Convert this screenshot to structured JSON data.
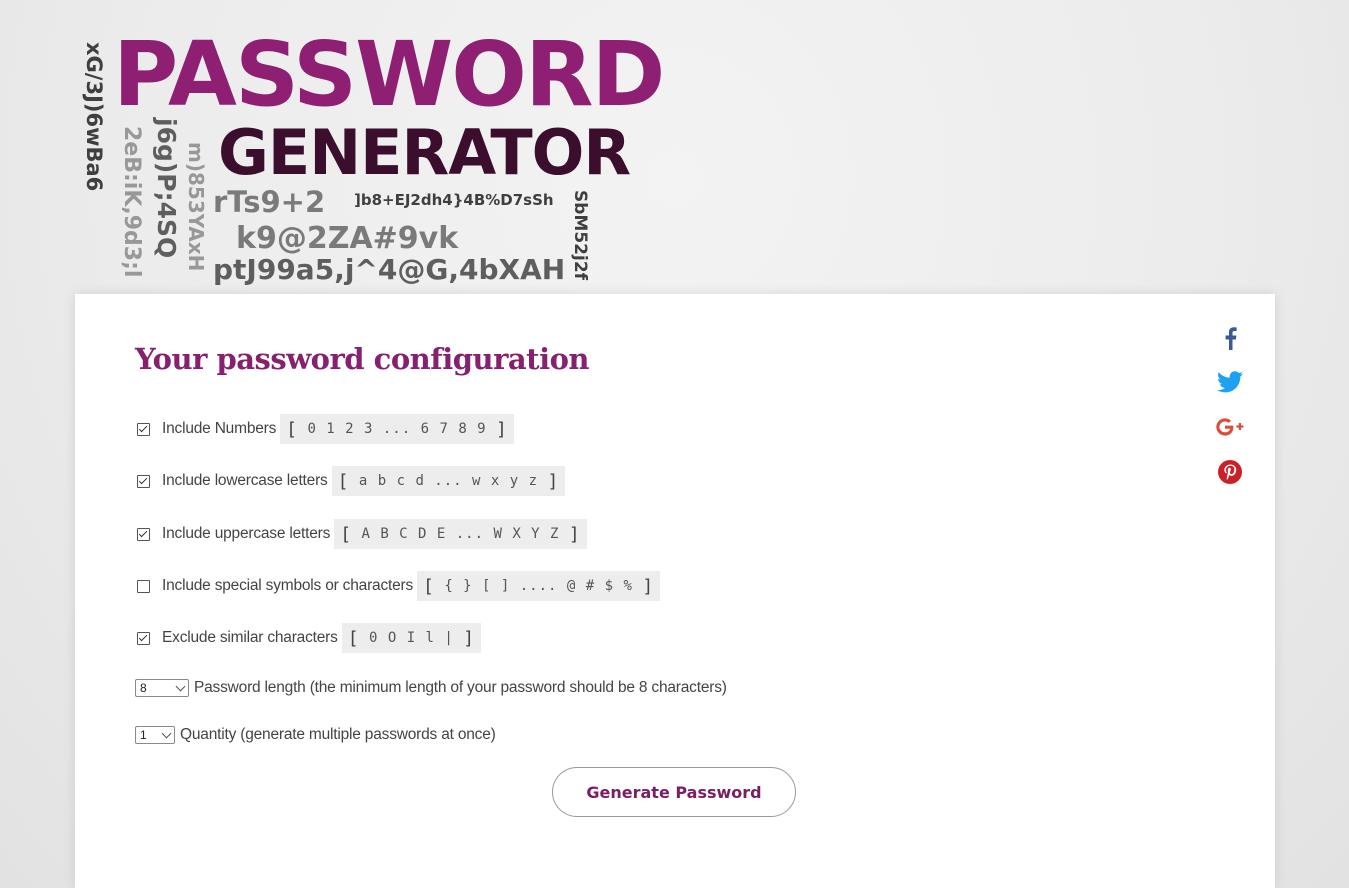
{
  "logo": {
    "title": "PASSWORD",
    "subtitle": "GENERATOR",
    "samples": {
      "s1": "xG/3J)6wBa6",
      "s2": "2eB:iK,9d3;l",
      "s3": "j6g)P;4SQ",
      "s4": "m)853YAxH",
      "s5": "rTs9+2",
      "s6": "]b8+EJ2dh4}4B%D7sSh",
      "s7": "k9@2ZA#9vk",
      "s8": "ptJ99a5,j^4@G,4bXAH",
      "s9": "SbM52j2f"
    }
  },
  "config": {
    "title": "Your password configuration",
    "options": [
      {
        "label": "Include Numbers",
        "chars": "0 1 2 3 ... 6 7 8 9",
        "checked": true
      },
      {
        "label": "Include lowercase letters",
        "chars": "a b c d ... w x y z",
        "checked": true
      },
      {
        "label": "Include uppercase letters",
        "chars": "A B C D E ... W X Y Z",
        "checked": true
      },
      {
        "label": "Include special symbols or characters",
        "chars": "{ } [ ] .... @ # $ %",
        "checked": false
      },
      {
        "label": "Exclude similar characters",
        "chars": "0 O I l |",
        "checked": true
      }
    ],
    "length": {
      "value": "8",
      "label": "Password length (the minimum length of your password should be 8 characters)"
    },
    "quantity": {
      "value": "1",
      "label": "Quantity (generate multiple passwords at once)"
    },
    "button": "Generate Password"
  },
  "social": {
    "facebook": {
      "icon": "facebook-icon",
      "color": "#3b5998"
    },
    "twitter": {
      "icon": "twitter-icon",
      "color": "#1da1f2"
    },
    "google_plus": {
      "icon": "google-plus-icon",
      "color": "#dd4b39"
    },
    "pinterest": {
      "icon": "pinterest-icon",
      "color": "#cb2027"
    }
  }
}
